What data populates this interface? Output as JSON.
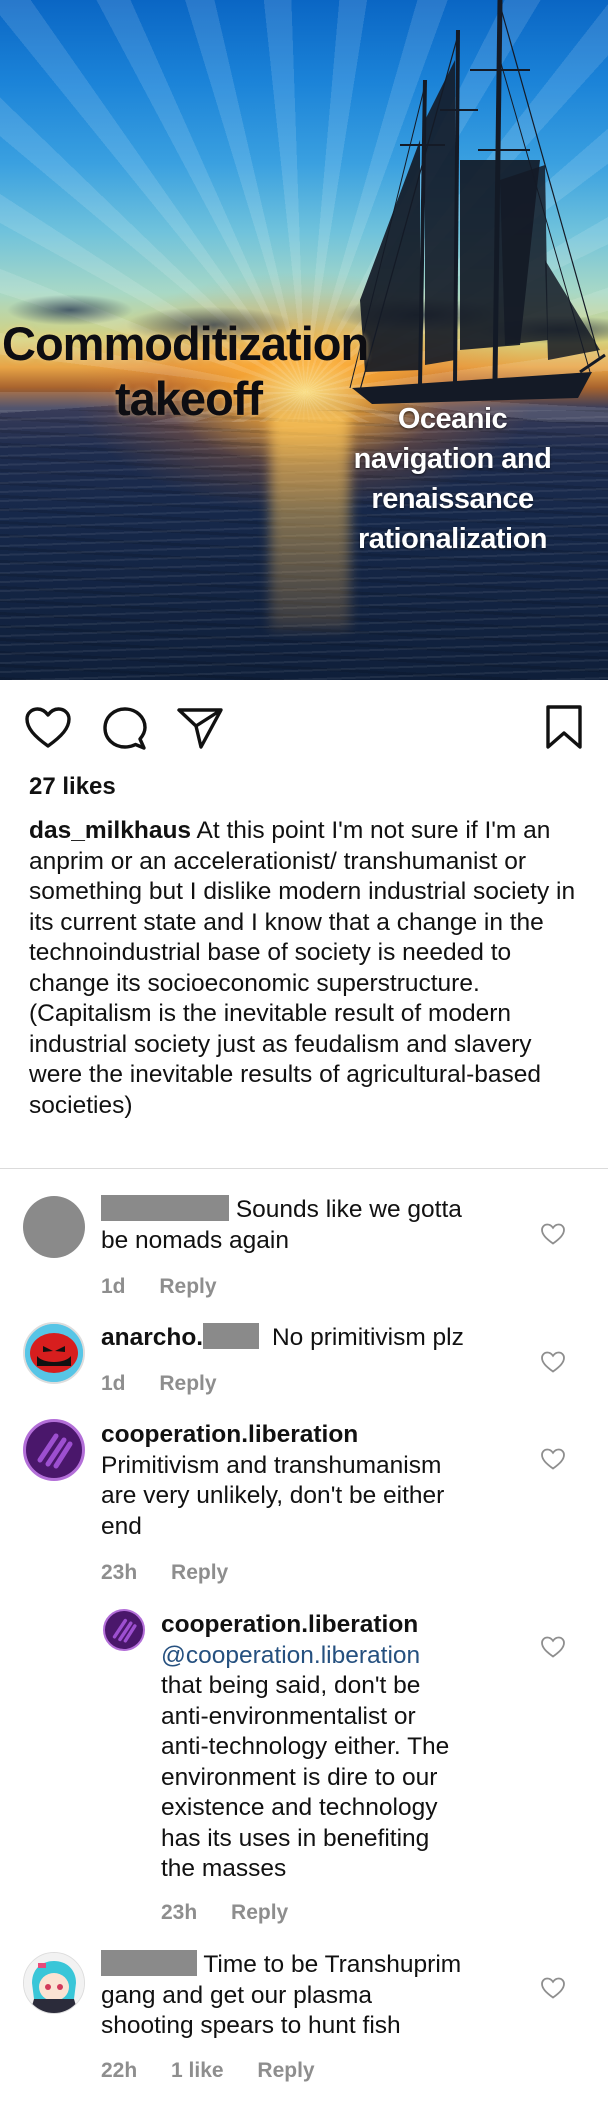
{
  "post": {
    "image": {
      "text_left_line1": "Commoditization",
      "text_left_line2": "takeoff",
      "text_right_line1": "Oceanic",
      "text_right_line2": "navigation and",
      "text_right_line3": "renaissance",
      "text_right_line4": "rationalization"
    },
    "actions": {
      "like_icon": "heart-outline-icon",
      "comment_icon": "speech-bubble-icon",
      "share_icon": "paper-plane-icon",
      "save_icon": "bookmark-icon"
    },
    "likes": "27 likes",
    "caption": {
      "username": "das_milkhaus",
      "text": "At this point I'm not sure if I'm an anprim or an accelerationist/ transhumanist or something but I dislike modern industrial society in its current state and I know that a change in the technoindustrial base of society is needed to change its socioeconomic superstructure. (Capitalism is the inevitable result of modern industrial society just as feudalism and slavery were the inevitable results of agricultural-based societies)"
    }
  },
  "comments": [
    {
      "text_line1": "Sounds like we gotta",
      "text_line2": "be nomads again",
      "time": "1d",
      "reply_label": "Reply"
    },
    {
      "username": "anarcho.",
      "text": "No primitivism plz",
      "time": "1d",
      "reply_label": "Reply"
    },
    {
      "username": "cooperation.liberation",
      "text_line1": "Primitivism and transhumanism",
      "text_line2": "are very unlikely, don't be either",
      "text_line3": "end",
      "time": "23h",
      "reply_label": "Reply",
      "reply": {
        "username": "cooperation.liberation",
        "mention": "@cooperation.liberation",
        "lines": [
          "that being said, don't be",
          "anti-environmentalist or",
          "anti-technology either. The",
          "environment is dire to our",
          "existence and technology",
          "has its uses in benefiting",
          "the masses"
        ],
        "time": "23h",
        "reply_label": "Reply"
      }
    },
    {
      "text_line1": "Time to be Transhuprim",
      "text_line2": "gang and get our plasma",
      "text_line3": "shooting spears to hunt fish",
      "time": "22h",
      "likes": "1 like",
      "reply_label": "Reply"
    }
  ]
}
